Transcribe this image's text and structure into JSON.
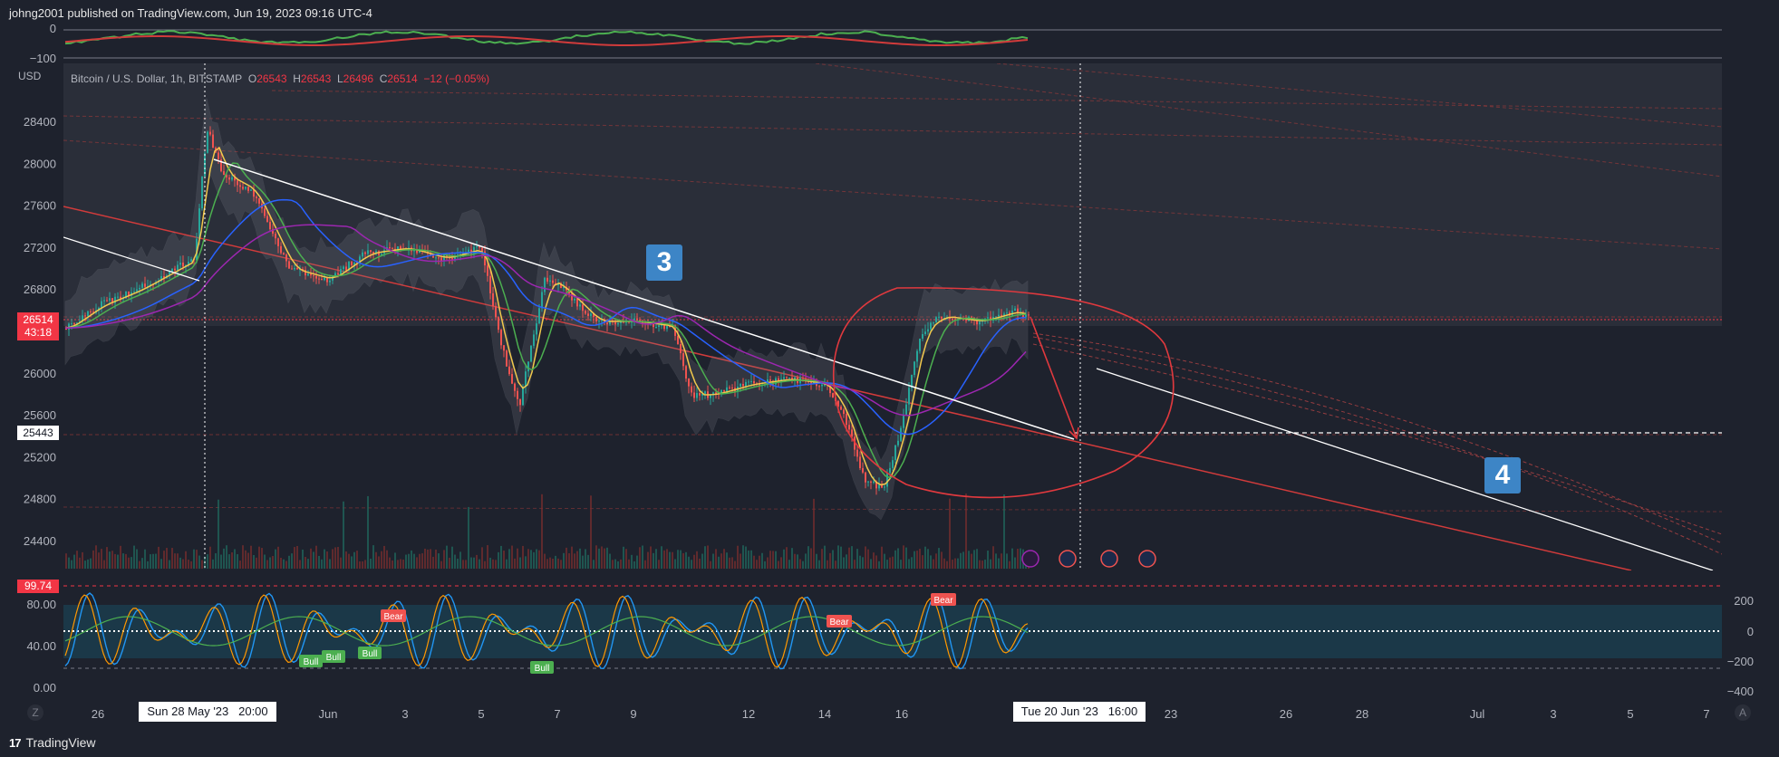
{
  "header": {
    "published": "johng2001 published on TradingView.com, Jun 19, 2023 09:16 UTC-4"
  },
  "footer": {
    "brand": "TradingView",
    "logo": "17"
  },
  "currency_label": "USD",
  "symbol_info": {
    "name": "Bitcoin / U.S. Dollar, 1h, BITSTAMP",
    "o_label": "O",
    "o": "26543",
    "h_label": "H",
    "h": "26543",
    "l_label": "L",
    "l": "26496",
    "c_label": "C",
    "c": "26514",
    "chg": "−12 (−0.05%)"
  },
  "price_badge": {
    "price": "26514",
    "countdown": "43:18"
  },
  "target_label": "25443",
  "osc_badge": "99.74",
  "annotations": {
    "wave3": "3",
    "wave4": "4"
  },
  "crosshair": {
    "left_date": "Sun 28 May '23   20:00",
    "right_date": "Tue 20 Jun '23   16:00"
  },
  "time_axis": [
    {
      "label": "26",
      "x": 108
    },
    {
      "label": "Jun",
      "x": 362
    },
    {
      "label": "3",
      "x": 447
    },
    {
      "label": "5",
      "x": 531
    },
    {
      "label": "7",
      "x": 615
    },
    {
      "label": "9",
      "x": 699
    },
    {
      "label": "12",
      "x": 826
    },
    {
      "label": "14",
      "x": 910
    },
    {
      "label": "16",
      "x": 995
    },
    {
      "label": "23",
      "x": 1292
    },
    {
      "label": "26",
      "x": 1419
    },
    {
      "label": "28",
      "x": 1503
    },
    {
      "label": "Jul",
      "x": 1630
    },
    {
      "label": "3",
      "x": 1714
    },
    {
      "label": "5",
      "x": 1799
    },
    {
      "label": "7",
      "x": 1883
    }
  ],
  "axis_corner_left": "Z",
  "axis_corner_right": "A",
  "events": [
    "lightning-icon",
    "us-flag-icon",
    "us-flag-icon",
    "us-flag-icon"
  ],
  "osc_labels": {
    "bull": "Bull",
    "bear": "Bear"
  },
  "colors": {
    "bg": "#1e222d",
    "up": "#26a69a",
    "down": "#ef5350",
    "accent_red": "#f23645",
    "badge_blue": "#3d85c6"
  },
  "chart_data": [
    {
      "type": "line",
      "title": "Bitcoin / U.S. Dollar, 1h, BITSTAMP",
      "ylabel": "USD",
      "ylim": [
        24200,
        28800
      ],
      "yticks": [
        24400,
        24800,
        25200,
        25600,
        26000,
        26400,
        26800,
        27200,
        27600,
        28000,
        28400
      ],
      "x_range": [
        "2023-05-25",
        "2023-07-08"
      ],
      "series": [
        {
          "values": [
            [
              "2023-05-24T00:00",
              26100
            ],
            [
              "2023-05-25T00:00",
              26400
            ],
            [
              "2023-05-26T00:00",
              26650
            ],
            [
              "2023-05-27T00:00",
              26800
            ],
            [
              "2023-05-28T12:00",
              27100
            ],
            [
              "2023-05-28T20:00",
              28350
            ],
            [
              "2023-05-29T06:00",
              27900
            ],
            [
              "2023-05-30T00:00",
              27750
            ],
            [
              "2023-05-31T00:00",
              27000
            ],
            [
              "2023-06-01T00:00",
              26900
            ],
            [
              "2023-06-02T00:00",
              27150
            ],
            [
              "2023-06-03T00:00",
              27200
            ],
            [
              "2023-06-04T00:00",
              27100
            ],
            [
              "2023-06-05T00:00",
              27200
            ],
            [
              "2023-06-05T12:00",
              26300
            ],
            [
              "2023-06-06T00:00",
              25700
            ],
            [
              "2023-06-06T16:00",
              26900
            ],
            [
              "2023-06-07T00:00",
              26850
            ],
            [
              "2023-06-08T00:00",
              26500
            ],
            [
              "2023-06-09T00:00",
              26500
            ],
            [
              "2023-06-10T00:00",
              26450
            ],
            [
              "2023-06-10T12:00",
              25800
            ],
            [
              "2023-06-11T00:00",
              25800
            ],
            [
              "2023-06-12T00:00",
              25900
            ],
            [
              "2023-06-13T00:00",
              25950
            ],
            [
              "2023-06-14T00:00",
              25900
            ],
            [
              "2023-06-14T12:00",
              25600
            ],
            [
              "2023-06-15T00:00",
              25000
            ],
            [
              "2023-06-15T12:00",
              24900
            ],
            [
              "2023-06-16T00:00",
              25500
            ],
            [
              "2023-06-16T12:00",
              26400
            ],
            [
              "2023-06-17T00:00",
              26550
            ],
            [
              "2023-06-18T00:00",
              26500
            ],
            [
              "2023-06-19T00:00",
              26600
            ],
            [
              "2023-06-19T09:00",
              26514
            ]
          ]
        }
      ],
      "grid": false
    },
    {
      "type": "line",
      "title": "",
      "ylim": [
        -100,
        0
      ],
      "yticks": [
        0,
        -100
      ]
    },
    {
      "type": "line",
      "title": "",
      "ylim": [
        0,
        100
      ],
      "yticks_left": [
        0,
        40,
        80
      ],
      "yticks_right": [
        200,
        0,
        -200,
        -400
      ],
      "last_value": 99.74
    }
  ]
}
